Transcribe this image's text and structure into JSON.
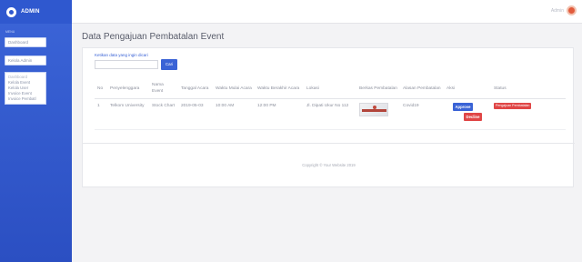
{
  "header": {
    "brand": "ADMIN",
    "user_name": "Admin"
  },
  "sidebar": {
    "section": "MENU",
    "buttons": [
      {
        "label": "Dashboard"
      },
      {
        "label": "Kelola Admin"
      }
    ],
    "menu": {
      "heading": "Dashboard",
      "items": [
        "Kelola Event",
        "Kelola User",
        "Invoice Event",
        "Invoice Pembatl"
      ]
    }
  },
  "main": {
    "page_title": "Data Pengajuan Pembatalan Event",
    "search": {
      "label": "Ketikan data yang ingin dicari",
      "value": "",
      "button": "Cari"
    },
    "table": {
      "headers": [
        "No",
        "Penyelenggara",
        "Nama Event",
        "Tanggal Acara",
        "Waktu Mulai Acara",
        "Waktu Berakhir Acara",
        "Lokasi",
        "Berkas Pembatalan",
        "Alasan Pembatalan",
        "Aksi",
        "Status"
      ],
      "rows": [
        {
          "no": "1",
          "penyelenggara": "Telkom University",
          "nama_event": "Stock Chart",
          "tanggal": "2019-05-03",
          "mulai": "10:00 AM",
          "berakhir": "12:00 PM",
          "lokasi": "Jl. Dipati Ukur No 112",
          "alasan": "Covid19",
          "approve": "Approve",
          "decline": "Decline",
          "status": "Pengajuan Pembatalan"
        }
      ]
    },
    "footer": "Copyright © Your Website 2019"
  },
  "colors": {
    "primary": "#3a63d6",
    "danger": "#e04646",
    "sidebar": "#2f58cf"
  }
}
